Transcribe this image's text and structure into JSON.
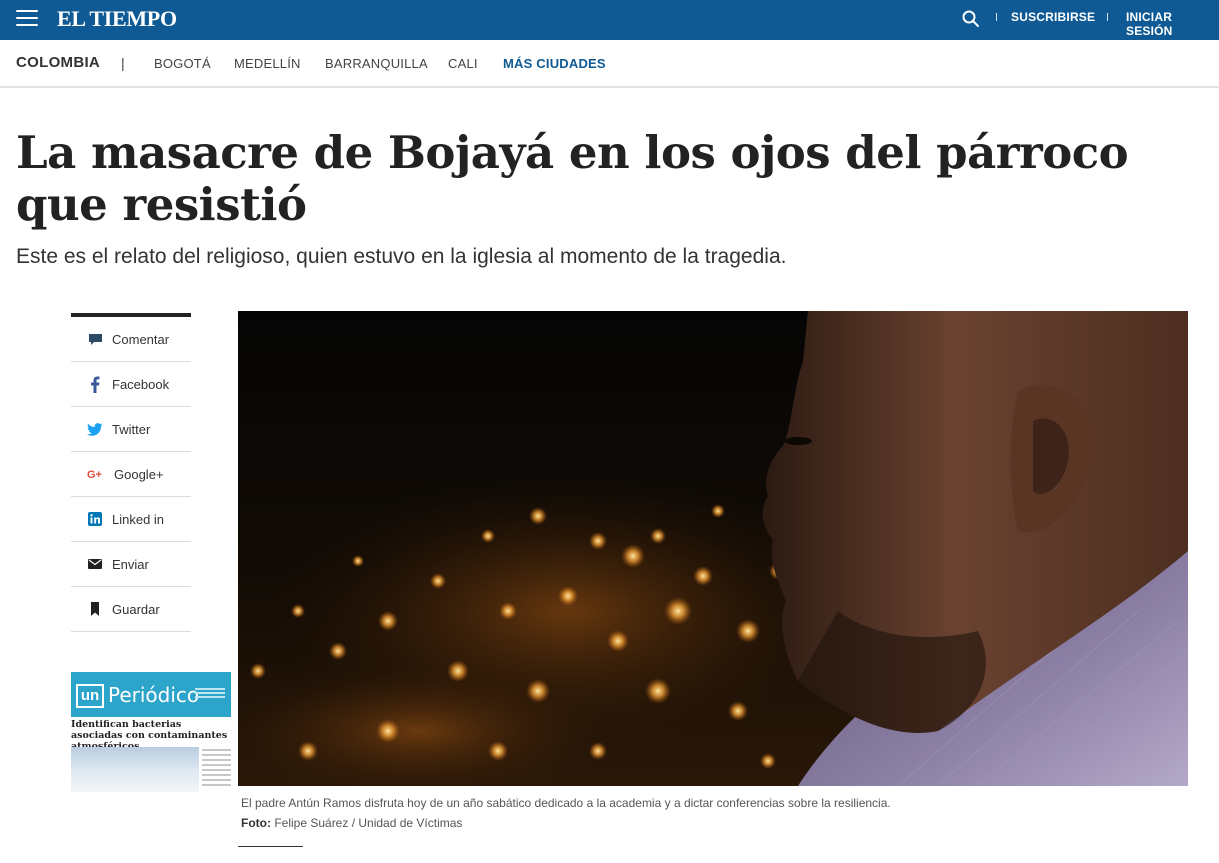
{
  "header": {
    "logo": "EL TIEMPO",
    "subscribe_label": "SUSCRIBIRSE",
    "login_label": "INICIAR SESIÓN",
    "brand_color": "#0f5a94"
  },
  "section_nav": {
    "current": "COLOMBIA",
    "separator": "|",
    "items": [
      "BOGOTÁ",
      "MEDELLÍN",
      "BARRANQUILLA",
      "CALI"
    ],
    "more_label": "MÁS CIUDADES"
  },
  "article": {
    "headline": "La masacre de Bojayá en los ojos del párroco que resistió",
    "subheadline": "Este es el relato del religioso, quien estuvo en la iglesia al momento de la tragedia.",
    "caption": "El padre Antún Ramos disfruta hoy de un año sabático dedicado a la academia y a dictar conferencias sobre la resiliencia.",
    "credit_label": "Foto:",
    "credit_value": " Felipe Suárez / Unidad de Víctimas"
  },
  "share": {
    "items": [
      {
        "label": "Comentar",
        "icon": "comment-icon"
      },
      {
        "label": "Facebook",
        "icon": "facebook-icon"
      },
      {
        "label": "Twitter",
        "icon": "twitter-icon"
      },
      {
        "label": "Google+",
        "icon": "google-plus-icon"
      },
      {
        "label": "Linked in",
        "icon": "linkedin-icon"
      },
      {
        "label": "Enviar",
        "icon": "mail-icon"
      },
      {
        "label": "Guardar",
        "icon": "bookmark-icon"
      }
    ]
  },
  "ad": {
    "logo_mark": "un",
    "logo_text": "Periódico",
    "headline": "Identifican bacterias asociadas con contaminantes atmosféricos"
  }
}
